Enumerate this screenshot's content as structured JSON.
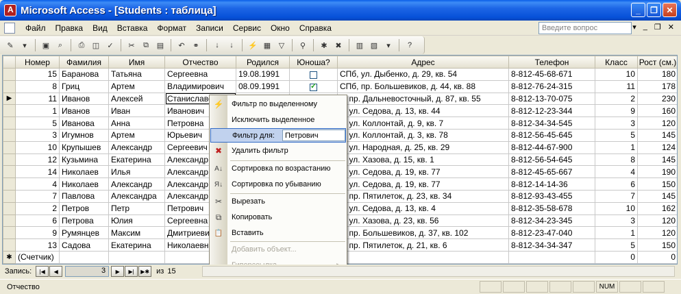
{
  "window": {
    "title": "Microsoft Access - [Students : таблица]",
    "controls": {
      "minimize": "_",
      "restore": "❐",
      "close": "✕"
    }
  },
  "menu": {
    "items": [
      "Файл",
      "Правка",
      "Вид",
      "Вставка",
      "Формат",
      "Записи",
      "Сервис",
      "Окно",
      "Справка"
    ],
    "ask_placeholder": "Введите вопрос",
    "right": [
      "▾",
      "_",
      "❐",
      "✕"
    ]
  },
  "datasheet": {
    "columns": [
      "Номер",
      "Фамилия",
      "Имя",
      "Отчество",
      "Родился",
      "Юноша?",
      "Адрес",
      "Телефон",
      "Класс",
      "Рост (см.)"
    ],
    "rows": [
      {
        "num": "15",
        "fam": "Баранова",
        "name": "Татьяна",
        "otch": "Сергеевна",
        "born": "19.08.1991",
        "boy": false,
        "addr": "СПб, ул. Дыбенко, д. 29, кв. 54",
        "tel": "8-812-45-68-671",
        "cls": "10",
        "h": "180",
        "marker": ""
      },
      {
        "num": "8",
        "fam": "Гриц",
        "name": "Артем",
        "otch": "Владимирович",
        "born": "08.09.1991",
        "boy": true,
        "addr": "СПб, пр. Большевиков, д. 44, кв. 88",
        "tel": "8-812-76-24-315",
        "cls": "11",
        "h": "178",
        "marker": ""
      },
      {
        "num": "11",
        "fam": "Иванов",
        "name": "Алексей",
        "otch": "Станиславо",
        "born": "",
        "boy": null,
        "addr": "б, пр. Дальневосточный, д. 87, кв. 55",
        "tel": "8-812-13-70-075",
        "cls": "2",
        "h": "230",
        "marker": "▶"
      },
      {
        "num": "1",
        "fam": "Иванов",
        "name": "Иван",
        "otch": "Иванович",
        "born": "",
        "boy": null,
        "addr": "б, ул. Седова, д. 13, кв. 44",
        "tel": "8-812-12-23-344",
        "cls": "9",
        "h": "160",
        "marker": ""
      },
      {
        "num": "5",
        "fam": "Иванова",
        "name": "Анна",
        "otch": "Петровна",
        "born": "",
        "boy": null,
        "addr": "б, ул. Коллонтай, д. 9, кв. 7",
        "tel": "8-812-34-34-545",
        "cls": "3",
        "h": "120",
        "marker": ""
      },
      {
        "num": "3",
        "fam": "Игумнов",
        "name": "Артем",
        "otch": "Юрьевич",
        "born": "",
        "boy": null,
        "addr": "б, ул. Коллонтай, д. 3, кв. 78",
        "tel": "8-812-56-45-645",
        "cls": "5",
        "h": "145",
        "marker": ""
      },
      {
        "num": "10",
        "fam": "Крупышев",
        "name": "Александр",
        "otch": "Сергеевич",
        "born": "",
        "boy": null,
        "addr": "б, ул. Народная, д. 25, кв. 29",
        "tel": "8-812-44-67-900",
        "cls": "1",
        "h": "124",
        "marker": ""
      },
      {
        "num": "12",
        "fam": "Кузьмина",
        "name": "Екатерина",
        "otch": "Александр",
        "born": "",
        "boy": null,
        "addr": "б, ул. Хазова, д. 15, кв. 1",
        "tel": "8-812-56-54-645",
        "cls": "8",
        "h": "145",
        "marker": ""
      },
      {
        "num": "14",
        "fam": "Николаев",
        "name": "Илья",
        "otch": "Александр",
        "born": "",
        "boy": null,
        "addr": "б, ул. Седова, д. 19, кв. 77",
        "tel": "8-812-45-65-667",
        "cls": "4",
        "h": "190",
        "marker": ""
      },
      {
        "num": "4",
        "fam": "Николаев",
        "name": "Александр",
        "otch": "Александр",
        "born": "",
        "boy": null,
        "addr": "б, ул. Седова, д. 19, кв. 77",
        "tel": "8-812-14-14-36",
        "cls": "6",
        "h": "150",
        "marker": ""
      },
      {
        "num": "7",
        "fam": "Павлова",
        "name": "Александра",
        "otch": "Александр",
        "born": "",
        "boy": null,
        "addr": "б, пр. Пятилеток, д. 23, кв. 34",
        "tel": "8-812-93-43-455",
        "cls": "7",
        "h": "145",
        "marker": ""
      },
      {
        "num": "2",
        "fam": "Петров",
        "name": "Петр",
        "otch": "Петрович",
        "born": "",
        "boy": null,
        "addr": "б, ул. Седова, д. 13, кв. 4",
        "tel": "8-812-35-58-678",
        "cls": "10",
        "h": "162",
        "marker": ""
      },
      {
        "num": "6",
        "fam": "Петрова",
        "name": "Юлия",
        "otch": "Сергеевна",
        "born": "",
        "boy": null,
        "addr": "б, ул. Хазова, д. 23, кв. 56",
        "tel": "8-812-34-23-345",
        "cls": "3",
        "h": "120",
        "marker": ""
      },
      {
        "num": "9",
        "fam": "Румянцев",
        "name": "Максим",
        "otch": "Дмитриеви",
        "born": "",
        "boy": null,
        "addr": "б, пр. Большевиков, д. 37, кв. 102",
        "tel": "8-812-23-47-040",
        "cls": "1",
        "h": "120",
        "marker": ""
      },
      {
        "num": "13",
        "fam": "Садова",
        "name": "Екатерина",
        "otch": "Николаевна",
        "born": "",
        "boy": null,
        "addr": "б, пр. Пятилеток, д. 21, кв. 6",
        "tel": "8-812-34-34-347",
        "cls": "5",
        "h": "150",
        "marker": ""
      }
    ],
    "new_row": {
      "marker": "✱",
      "num": "(Счетчик)",
      "cls": "0",
      "h": "0"
    }
  },
  "context_menu": {
    "items": [
      {
        "label": "Фильтр по выделенному",
        "icon": "funnel-lightning-icon",
        "glyph": "⚡",
        "disabled": false
      },
      {
        "label": "Исключить выделенное",
        "icon": "",
        "glyph": "",
        "disabled": false
      },
      {
        "label": "Фильтр для:",
        "icon": "",
        "glyph": "",
        "disabled": false,
        "input_value": "Петрович"
      },
      {
        "label": "Удалить фильтр",
        "icon": "remove-filter-icon",
        "glyph": "✖",
        "disabled": false
      },
      {
        "label": "Сортировка по возрастанию",
        "icon": "sort-ascending-icon",
        "glyph": "A↓",
        "disabled": false
      },
      {
        "label": "Сортировка по убыванию",
        "icon": "sort-descending-icon",
        "glyph": "Я↓",
        "disabled": false
      },
      {
        "label": "Вырезать",
        "icon": "scissors-icon",
        "glyph": "✂",
        "disabled": false
      },
      {
        "label": "Копировать",
        "icon": "copy-icon",
        "glyph": "⧉",
        "disabled": false
      },
      {
        "label": "Вставить",
        "icon": "paste-icon",
        "glyph": "📋",
        "disabled": false
      },
      {
        "label": "Добавить объект...",
        "icon": "",
        "glyph": "",
        "disabled": true
      },
      {
        "label": "Гиперссылка",
        "icon": "",
        "glyph": "",
        "disabled": true,
        "submenu": "▶"
      }
    ]
  },
  "record_nav": {
    "label": "Запись:",
    "current": "3",
    "of_label": "из",
    "total": "15",
    "buttons": [
      "|◀",
      "◀",
      "▶",
      "▶|",
      "▶✱"
    ]
  },
  "status": {
    "text": "Отчество",
    "indicators": [
      "",
      "",
      "",
      "",
      "",
      "NUM",
      "",
      ""
    ]
  }
}
